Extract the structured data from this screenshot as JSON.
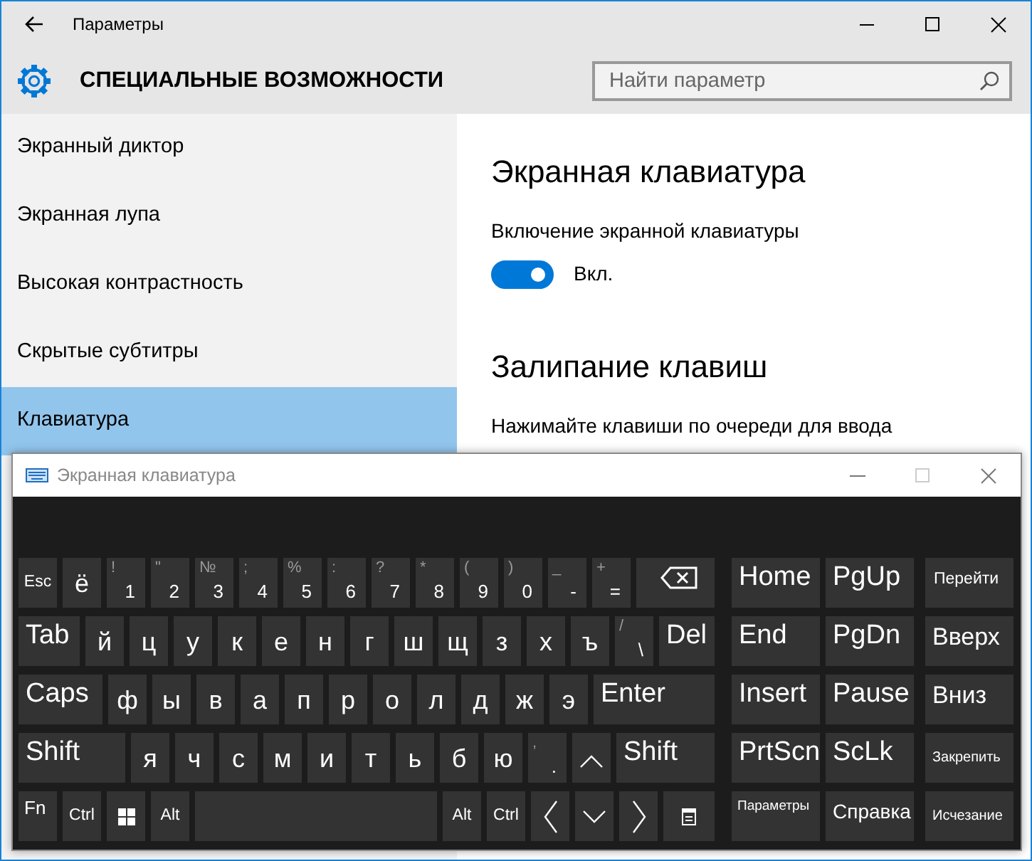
{
  "window": {
    "title": "Параметры"
  },
  "header": {
    "title": "СПЕЦИАЛЬНЫЕ ВОЗМОЖНОСТИ",
    "search": {
      "placeholder": "Найти параметр"
    }
  },
  "sidebar": {
    "items": [
      {
        "label": "Экранный диктор",
        "selected": false
      },
      {
        "label": "Экранная лупа",
        "selected": false
      },
      {
        "label": "Высокая контрастность",
        "selected": false
      },
      {
        "label": "Скрытые субтитры",
        "selected": false
      },
      {
        "label": "Клавиатура",
        "selected": true
      }
    ]
  },
  "content": {
    "sections": [
      {
        "heading": "Экранная клавиатура",
        "setting": {
          "label": "Включение экранной клавиатуры",
          "on": true,
          "state_text": "Вкл."
        }
      },
      {
        "heading": "Залипание клавиш",
        "text": "Нажимайте клавиши по очереди для ввода"
      }
    ]
  },
  "keyboard": {
    "title": "Экранная клавиатура",
    "main_rows": [
      [
        {
          "kind": "mod",
          "label": "Esc"
        },
        {
          "kind": "letter",
          "label": "ё"
        },
        {
          "kind": "digit",
          "label": "1",
          "shifted": "!"
        },
        {
          "kind": "digit",
          "label": "2",
          "shifted": "\""
        },
        {
          "kind": "digit",
          "label": "3",
          "shifted": "№"
        },
        {
          "kind": "digit",
          "label": "4",
          "shifted": ";"
        },
        {
          "kind": "digit",
          "label": "5",
          "shifted": "%"
        },
        {
          "kind": "digit",
          "label": "6",
          "shifted": ":"
        },
        {
          "kind": "digit",
          "label": "7",
          "shifted": "?"
        },
        {
          "kind": "digit",
          "label": "8",
          "shifted": "*"
        },
        {
          "kind": "digit",
          "label": "9",
          "shifted": "("
        },
        {
          "kind": "digit",
          "label": "0",
          "shifted": ")"
        },
        {
          "kind": "digit",
          "label": "-",
          "shifted": "_"
        },
        {
          "kind": "digit",
          "label": "=",
          "shifted": "+"
        },
        {
          "kind": "backspace"
        }
      ],
      [
        {
          "kind": "tab",
          "label": "Tab"
        },
        {
          "kind": "letter",
          "label": "й"
        },
        {
          "kind": "letter",
          "label": "ц"
        },
        {
          "kind": "letter",
          "label": "у"
        },
        {
          "kind": "letter",
          "label": "к"
        },
        {
          "kind": "letter",
          "label": "е"
        },
        {
          "kind": "letter",
          "label": "н"
        },
        {
          "kind": "letter",
          "label": "г"
        },
        {
          "kind": "letter",
          "label": "ш"
        },
        {
          "kind": "letter",
          "label": "щ"
        },
        {
          "kind": "letter",
          "label": "з"
        },
        {
          "kind": "letter",
          "label": "х"
        },
        {
          "kind": "letter",
          "label": "ъ"
        },
        {
          "kind": "digit",
          "label": "\\",
          "shifted": "/"
        },
        {
          "kind": "fill",
          "label": "Del"
        }
      ],
      [
        {
          "kind": "caps",
          "label": "Caps"
        },
        {
          "kind": "letter",
          "label": "ф"
        },
        {
          "kind": "letter",
          "label": "ы"
        },
        {
          "kind": "letter",
          "label": "в"
        },
        {
          "kind": "letter",
          "label": "а"
        },
        {
          "kind": "letter",
          "label": "п"
        },
        {
          "kind": "letter",
          "label": "р"
        },
        {
          "kind": "letter",
          "label": "о"
        },
        {
          "kind": "letter",
          "label": "л"
        },
        {
          "kind": "letter",
          "label": "д"
        },
        {
          "kind": "letter",
          "label": "ж"
        },
        {
          "kind": "letter",
          "label": "э"
        },
        {
          "kind": "fill",
          "label": "Enter"
        }
      ],
      [
        {
          "kind": "shift",
          "label": "Shift"
        },
        {
          "kind": "letter",
          "label": "я"
        },
        {
          "kind": "letter",
          "label": "ч"
        },
        {
          "kind": "letter",
          "label": "с"
        },
        {
          "kind": "letter",
          "label": "м"
        },
        {
          "kind": "letter",
          "label": "и"
        },
        {
          "kind": "letter",
          "label": "т"
        },
        {
          "kind": "letter",
          "label": "ь"
        },
        {
          "kind": "letter",
          "label": "б"
        },
        {
          "kind": "letter",
          "label": "ю"
        },
        {
          "kind": "digit",
          "label": ".",
          "shifted": ","
        },
        {
          "kind": "arrow-up"
        },
        {
          "kind": "fill",
          "label": "Shift"
        }
      ],
      [
        {
          "kind": "mod-top",
          "label": "Fn"
        },
        {
          "kind": "mod",
          "label": "Ctrl"
        },
        {
          "kind": "win"
        },
        {
          "kind": "mod",
          "label": "Alt"
        },
        {
          "kind": "space"
        },
        {
          "kind": "mod",
          "label": "Alt"
        },
        {
          "kind": "mod",
          "label": "Ctrl"
        },
        {
          "kind": "arrow-left"
        },
        {
          "kind": "arrow-down"
        },
        {
          "kind": "arrow-right"
        },
        {
          "kind": "menu"
        }
      ]
    ],
    "nav_rows": [
      [
        {
          "kind": "nav",
          "label": "Home"
        },
        {
          "kind": "nav",
          "label": "PgUp"
        },
        {
          "kind": "cmd",
          "label": "Перейти"
        }
      ],
      [
        {
          "kind": "nav",
          "label": "End"
        },
        {
          "kind": "nav",
          "label": "PgDn"
        },
        {
          "kind": "cmd-big",
          "label": "Вверх"
        }
      ],
      [
        {
          "kind": "nav",
          "label": "Insert"
        },
        {
          "kind": "nav",
          "label": "Pause"
        },
        {
          "kind": "cmd-big",
          "label": "Вниз"
        }
      ],
      [
        {
          "kind": "nav",
          "label": "PrtScn"
        },
        {
          "kind": "nav",
          "label": "ScLk"
        },
        {
          "kind": "cmd-tiny",
          "label": "Закрепить"
        }
      ],
      [
        {
          "kind": "cmd-tiny-top",
          "label": "Параметры"
        },
        {
          "kind": "cmd-mid",
          "label": "Справка"
        },
        {
          "kind": "cmd-tiny",
          "label": "Исчезание"
        }
      ]
    ]
  }
}
